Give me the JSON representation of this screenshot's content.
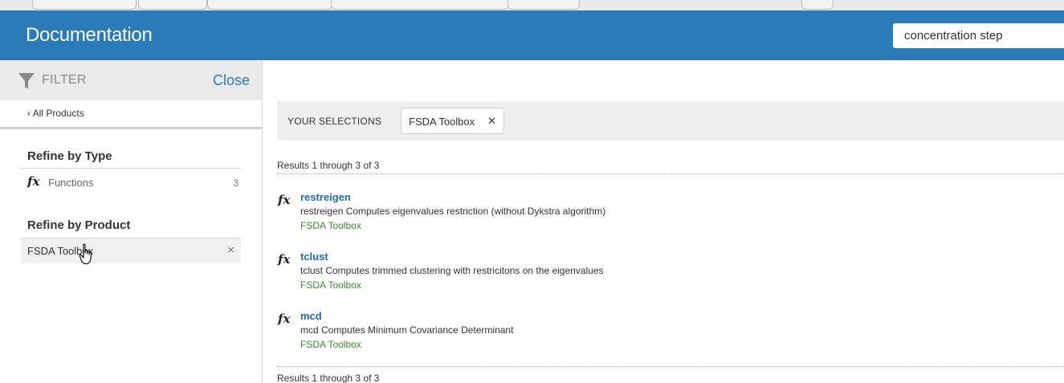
{
  "header": {
    "title": "Documentation",
    "search_value": "concentration step"
  },
  "sidebar": {
    "filter_label": "FILTER",
    "close_label": "Close",
    "all_products_label": "‹ All Products",
    "refine_by_type_heading": "Refine by Type",
    "type_items": [
      {
        "icon": "fx",
        "label": "Functions",
        "count": "3"
      }
    ],
    "refine_by_product_heading": "Refine by Product",
    "product_items": [
      {
        "label": "FSDA Toolbox",
        "remove": "×"
      }
    ]
  },
  "main": {
    "selections_label": "YOUR SELECTIONS",
    "selection_chip": "FSDA Toolbox",
    "selection_chip_remove": "✕",
    "results_summary_top": "Results 1 through 3 of 3",
    "results_summary_bottom": "Results 1 through 3 of 3",
    "results": [
      {
        "icon": "fx",
        "name": "restreigen",
        "description": "restreigen Computes eigenvalues restriction (without Dykstra algorithm)",
        "product": "FSDA Toolbox"
      },
      {
        "icon": "fx",
        "name": "tclust",
        "description": "tclust Computes trimmed clustering with restricitons on the eigenvalues",
        "product": "FSDA Toolbox"
      },
      {
        "icon": "fx",
        "name": "mcd",
        "description": "mcd Computes Minimum Covariance Determinant",
        "product": "FSDA Toolbox"
      }
    ]
  },
  "colors": {
    "header_bg": "#2b7bb9",
    "link_blue": "#1f6bb0",
    "product_green": "#3b8a2e"
  }
}
